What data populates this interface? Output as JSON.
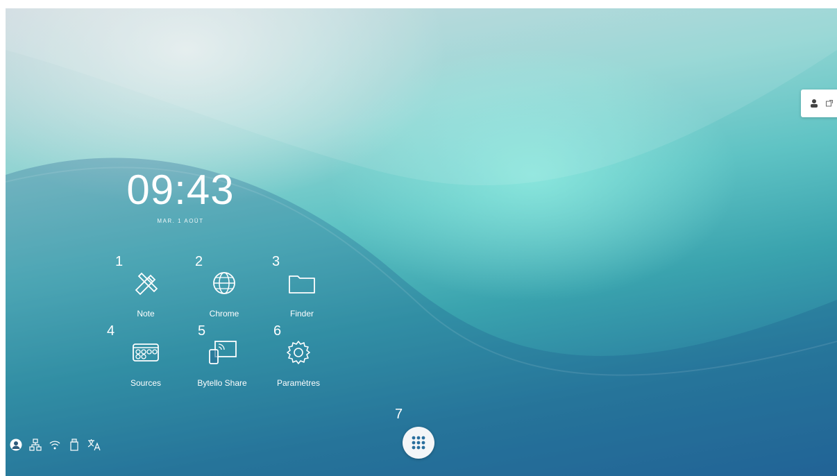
{
  "clock": {
    "time": "09:43",
    "date": "MAR. 1 AOÛT"
  },
  "apps": [
    {
      "num": "1",
      "label": "Note",
      "icon": "note-pencil-ruler-icon"
    },
    {
      "num": "2",
      "label": "Chrome",
      "icon": "globe-icon"
    },
    {
      "num": "3",
      "label": "Finder",
      "icon": "folder-icon"
    },
    {
      "num": "4",
      "label": "Sources",
      "icon": "input-sources-icon"
    },
    {
      "num": "5",
      "label": "Bytello Share",
      "icon": "screen-share-icon"
    },
    {
      "num": "6",
      "label": "Paramètres",
      "icon": "gear-icon"
    }
  ],
  "launcher": {
    "num": "7",
    "icon": "app-grid-icon"
  },
  "status_bar": [
    "user-avatar-icon",
    "ethernet-icon",
    "wifi-icon",
    "usb-icon",
    "language-icon"
  ],
  "side_panel": [
    "user-sign-in-icon",
    "external-link-icon"
  ],
  "colors": {
    "accent": "#2a7fa0",
    "wallpaper_light": "#8fd4d2",
    "wallpaper_dark": "#24679a"
  }
}
